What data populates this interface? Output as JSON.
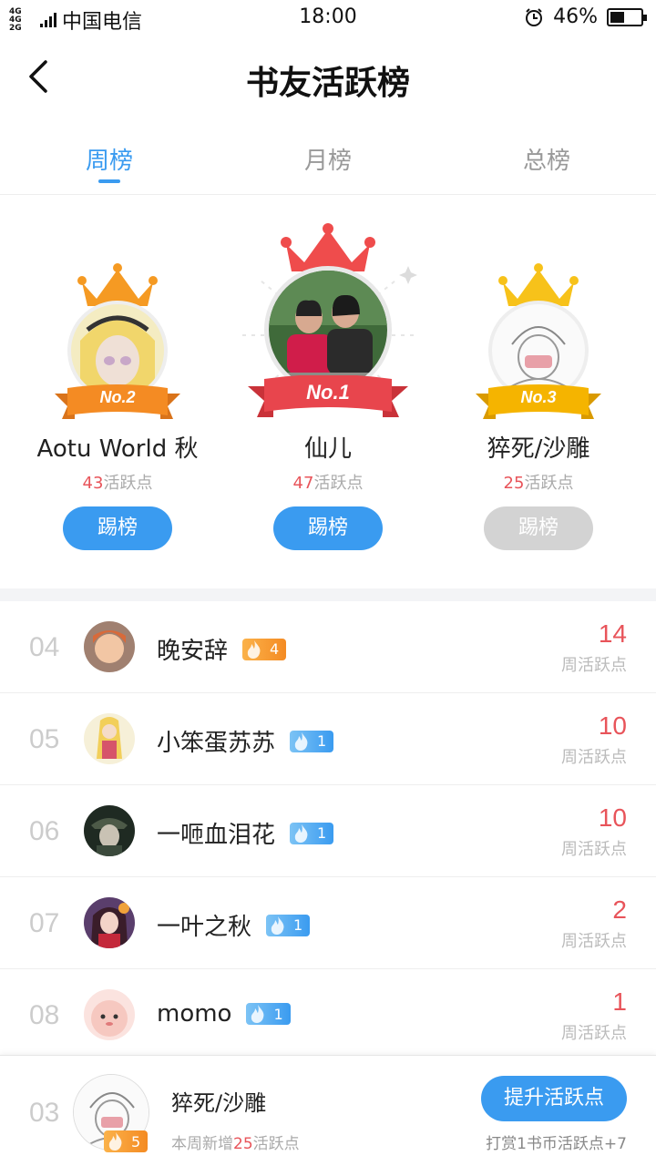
{
  "status_bar": {
    "network": "4G 4G 2G",
    "carrier": "中国电信",
    "time": "18:00",
    "battery": "46%",
    "battery_level": 0.46
  },
  "header": {
    "title": "书友活跃榜"
  },
  "tabs": [
    {
      "label": "周榜",
      "active": true
    },
    {
      "label": "月榜",
      "active": false
    },
    {
      "label": "总榜",
      "active": false
    }
  ],
  "podium": [
    {
      "rank_label": "No.2",
      "name": "Aotu World 秋",
      "score": "43",
      "score_unit": "活跃点",
      "button": "踢榜",
      "button_enabled": true,
      "crown_color": "#f59a23",
      "ribbon_color": "#f48b23"
    },
    {
      "rank_label": "No.1",
      "name": "仙儿",
      "score": "47",
      "score_unit": "活跃点",
      "button": "踢榜",
      "button_enabled": true,
      "crown_color": "#ef4c4c",
      "ribbon_color": "#e8454d"
    },
    {
      "rank_label": "No.3",
      "name": "猝死/沙雕",
      "score": "25",
      "score_unit": "活跃点",
      "button": "踢榜",
      "button_enabled": false,
      "crown_color": "#f7c21a",
      "ribbon_color": "#f5b400"
    }
  ],
  "ranking": [
    {
      "rank": "04",
      "name": "晚安辞",
      "badge": "4",
      "badge_color": "orange",
      "score": "14",
      "score_label": "周活跃点"
    },
    {
      "rank": "05",
      "name": "小笨蛋苏苏",
      "badge": "1",
      "badge_color": "blue",
      "score": "10",
      "score_label": "周活跃点"
    },
    {
      "rank": "06",
      "name": "一咂血泪花",
      "badge": "1",
      "badge_color": "blue",
      "score": "10",
      "score_label": "周活跃点"
    },
    {
      "rank": "07",
      "name": "一叶之秋",
      "badge": "1",
      "badge_color": "blue",
      "score": "2",
      "score_label": "周活跃点"
    },
    {
      "rank": "08",
      "name": "momo",
      "badge": "1",
      "badge_color": "blue",
      "score": "1",
      "score_label": "周活跃点"
    }
  ],
  "footer": {
    "rank": "03",
    "name": "猝死/沙雕",
    "badge": "5",
    "sub_prefix": "本周新增",
    "sub_num": "25",
    "sub_suffix": "活跃点",
    "button": "提升活跃点",
    "tip": "打赏1书币活跃点+7"
  },
  "colors": {
    "accent": "#3a9bf0",
    "score_red": "#e8545a"
  }
}
